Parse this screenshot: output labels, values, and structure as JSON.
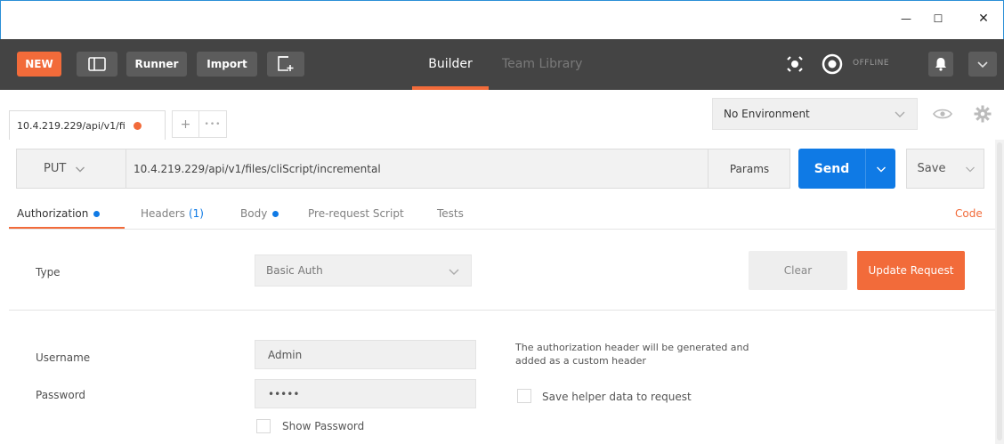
{
  "window": {
    "minimize": "—",
    "maximize": "☐",
    "close": "✕"
  },
  "header": {
    "new_label": "NEW",
    "runner_label": "Runner",
    "import_label": "Import",
    "tabs": [
      {
        "label": "Builder",
        "active": true
      },
      {
        "label": "Team Library",
        "active": false
      }
    ],
    "status": "OFFLINE",
    "accent_color": "#f26b3a"
  },
  "request_tab": {
    "label": "10.4.219.229/api/v1/fi",
    "more": "•••",
    "add": "+"
  },
  "environment": {
    "selected": "No Environment"
  },
  "request": {
    "method": "PUT",
    "url": "10.4.219.229/api/v1/files/cliScript/incremental",
    "params_label": "Params",
    "send_label": "Send",
    "save_label": "Save",
    "send_color": "#0f7ae5"
  },
  "request_tabs": {
    "authorization": "Authorization",
    "headers": "Headers",
    "headers_count": "(1)",
    "body": "Body",
    "pre_request": "Pre-request Script",
    "tests": "Tests",
    "code": "Code"
  },
  "auth": {
    "type_label": "Type",
    "type_value": "Basic Auth",
    "clear_label": "Clear",
    "update_label": "Update Request",
    "username_label": "Username",
    "username_value": "Admin",
    "password_label": "Password",
    "password_value": "•••••",
    "show_password_label": "Show Password",
    "note": "The authorization header will be generated and added as a custom header",
    "save_helper_label": "Save helper data to request"
  }
}
